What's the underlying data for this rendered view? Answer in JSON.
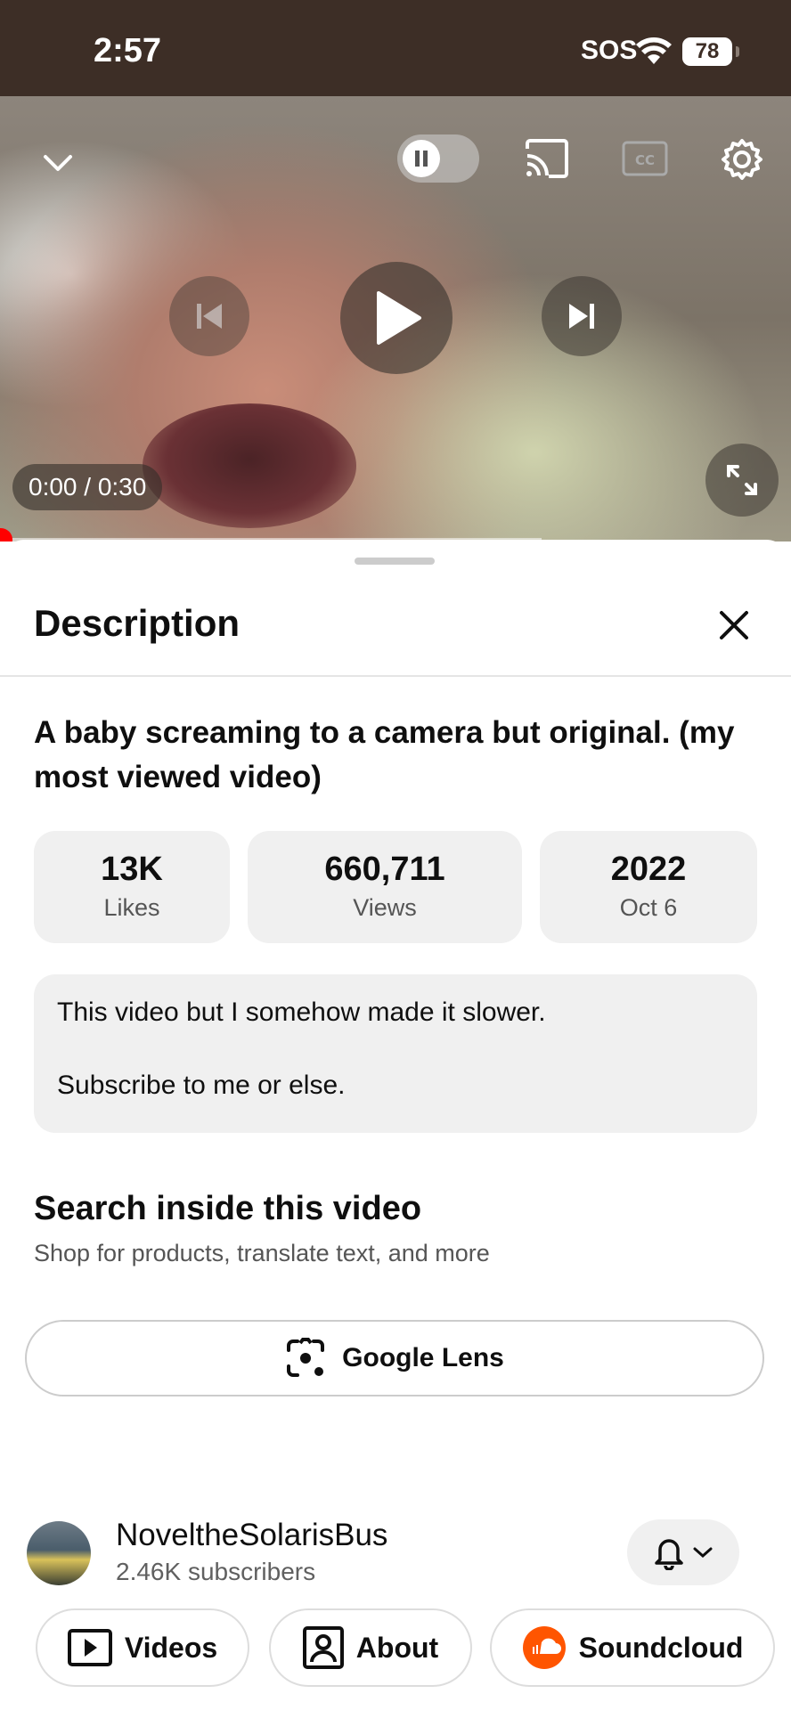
{
  "status": {
    "time": "2:57",
    "sos": "SOS",
    "battery": "78"
  },
  "player": {
    "time_display": "0:00 / 0:30",
    "progress": 0.0
  },
  "sheet": {
    "title": "Description",
    "video_title": "A baby screaming to a camera but original. (my most viewed video)",
    "stats": [
      {
        "value": "13K",
        "label": "Likes"
      },
      {
        "value": "660,711",
        "label": "Views"
      },
      {
        "value": "2022",
        "label": "Oct 6"
      }
    ],
    "description": [
      "This video but I somehow made it slower.",
      "Subscribe to me or else."
    ],
    "search": {
      "title": "Search inside this video",
      "subtitle": "Shop for products, translate text, and more",
      "lens_label": "Google Lens"
    },
    "channel": {
      "name": "NoveltheSolarisBus",
      "subscribers": "2.46K subscribers"
    },
    "tabs": [
      {
        "label": "Videos",
        "icon": "video-icon"
      },
      {
        "label": "About",
        "icon": "person-icon"
      },
      {
        "label": "Soundcloud",
        "icon": "soundcloud-icon"
      }
    ]
  },
  "colors": {
    "accent_red": "#ff0000",
    "status_bar": "#3d2e26",
    "soundcloud_orange": "#ff5500"
  }
}
